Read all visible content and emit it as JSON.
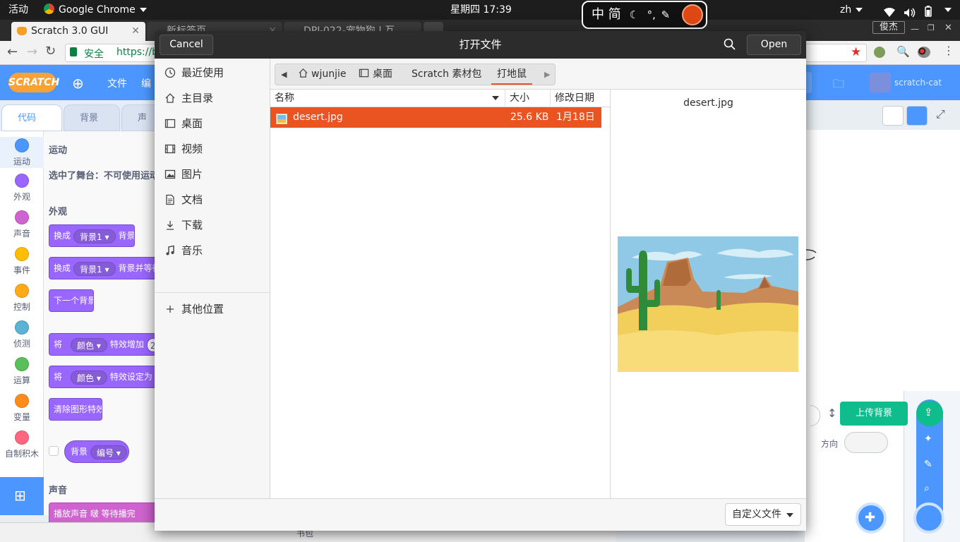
{
  "system_bar": {
    "activities": "活动",
    "app_name": "Google Chrome",
    "clock": "星期四 17:39",
    "ime_text": "中 简",
    "lang": "zh"
  },
  "browser": {
    "tabs": [
      {
        "title": "Scratch 3.0 GUI",
        "active": true
      },
      {
        "title": "新标签页",
        "active": false
      },
      {
        "title": "DPJ-022-宠物狗 | 互",
        "active": false
      }
    ],
    "window_user": "俊杰",
    "secure_label": "安全",
    "url": "https://b"
  },
  "scratch": {
    "logo": "SCRATCH",
    "menu_file": "文件",
    "menu_edit": "编",
    "user": "scratch-cat",
    "tabs": {
      "code": "代码",
      "backdrops": "背景",
      "sounds": "声"
    },
    "categories": [
      {
        "label": "运动",
        "color": "#4c97ff"
      },
      {
        "label": "外观",
        "color": "#9966ff"
      },
      {
        "label": "声音",
        "color": "#cf63cf"
      },
      {
        "label": "事件",
        "color": "#ffbf00"
      },
      {
        "label": "控制",
        "color": "#ffab19"
      },
      {
        "label": "侦测",
        "color": "#5cb1d6"
      },
      {
        "label": "运算",
        "color": "#59c059"
      },
      {
        "label": "变量",
        "color": "#ff8c1a"
      },
      {
        "label": "自制积木",
        "color": "#ff6680"
      }
    ],
    "palette": {
      "motion_heading": "运动",
      "motion_note": "选中了舞台：不可使用运动",
      "looks_heading": "外观",
      "block1_a": "换成",
      "block1_pill": "背景1",
      "block1_b": "背景",
      "block2_a": "换成",
      "block2_pill": "背景1",
      "block2_b": "背景并等待",
      "block3": "下一个背景",
      "block4_a": "将",
      "block4_pill": "颜色",
      "block4_b": "特效增加",
      "block4_val": "2",
      "block5_a": "将",
      "block5_pill": "颜色",
      "block5_b": "特效设定为",
      "block6": "清除图形特效",
      "block7_a": "背景",
      "block7_pill": "编号",
      "sound_heading": "声音",
      "block8": "播放声音 啵 等待播完"
    },
    "upload_backdrop": "上传背景",
    "direction_label": "方向",
    "backpack": "书包"
  },
  "dialog": {
    "title": "打开文件",
    "cancel": "Cancel",
    "open": "Open",
    "places": [
      {
        "label": "最近使用",
        "icon": "recent-icon"
      },
      {
        "label": "主目录",
        "icon": "home-icon"
      },
      {
        "label": "桌面",
        "icon": "desktop-icon"
      },
      {
        "label": "视频",
        "icon": "video-icon"
      },
      {
        "label": "图片",
        "icon": "pictures-icon"
      },
      {
        "label": "文档",
        "icon": "documents-icon"
      },
      {
        "label": "下载",
        "icon": "download-icon"
      },
      {
        "label": "音乐",
        "icon": "music-icon"
      }
    ],
    "other_locations": "其他位置",
    "breadcrumbs": [
      "wjunjie",
      "桌面",
      "Scratch 素材包",
      "打地鼠"
    ],
    "columns": {
      "name": "名称",
      "size": "大小",
      "modified": "修改日期"
    },
    "files": [
      {
        "name": "desert.jpg",
        "size": "25.6 KB",
        "modified": "1月18日",
        "selected": true
      }
    ],
    "preview_filename": "desert.jpg",
    "filter": "自定义文件",
    "accent_color": "#e95420"
  }
}
